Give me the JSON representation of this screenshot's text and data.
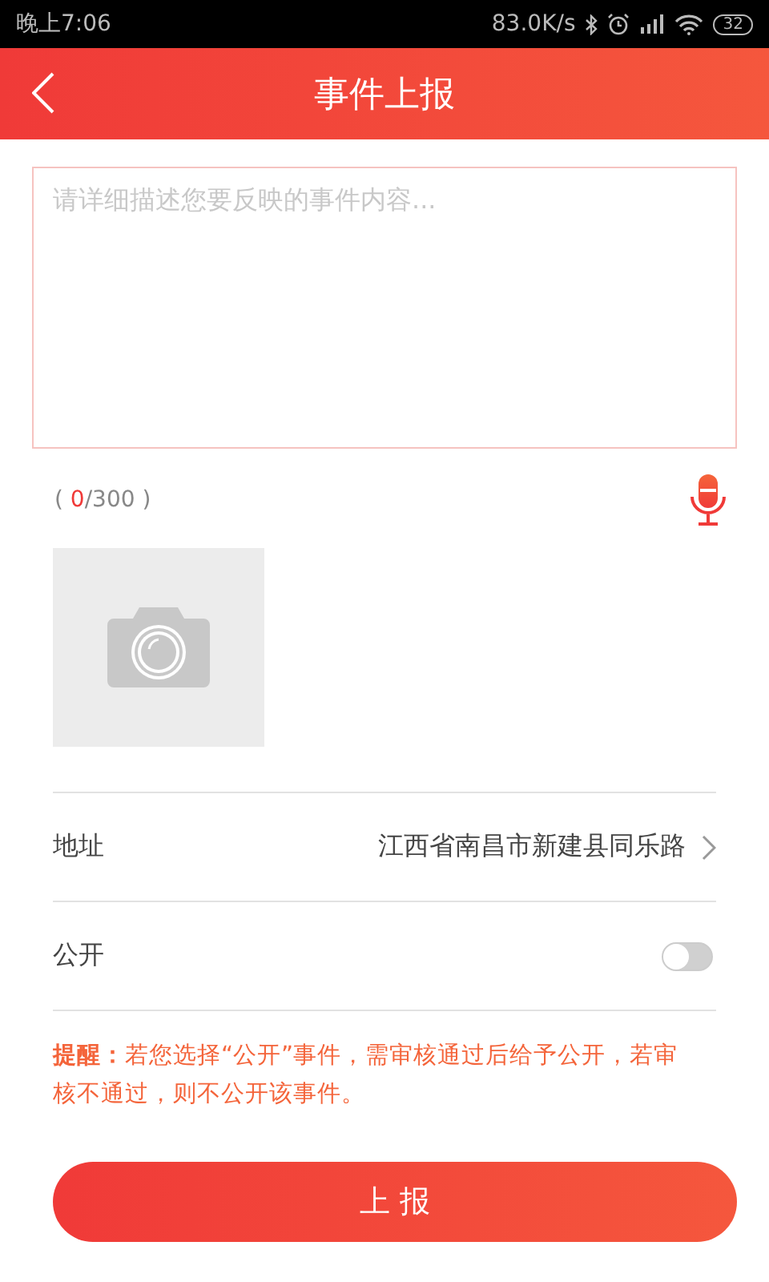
{
  "status_bar": {
    "time": "晚上7:06",
    "speed": "83.0K/s",
    "battery": "32"
  },
  "header": {
    "title": "事件上报"
  },
  "description": {
    "placeholder": "请详细描述您要反映的事件内容..."
  },
  "counter": {
    "prefix": "( ",
    "count": "0",
    "suffix": "/300 )"
  },
  "photo": {
    "kind": "add_photo"
  },
  "address": {
    "label": "地址",
    "value": "江西省南昌市新建县同乐路"
  },
  "public": {
    "label": "公开",
    "on": false
  },
  "notice": "**提醒：**若您选择“公开”事件，需审核通过后给予公开，若审核不通过，则不公开该事件。",
  "submit": {
    "label": "上 报"
  }
}
